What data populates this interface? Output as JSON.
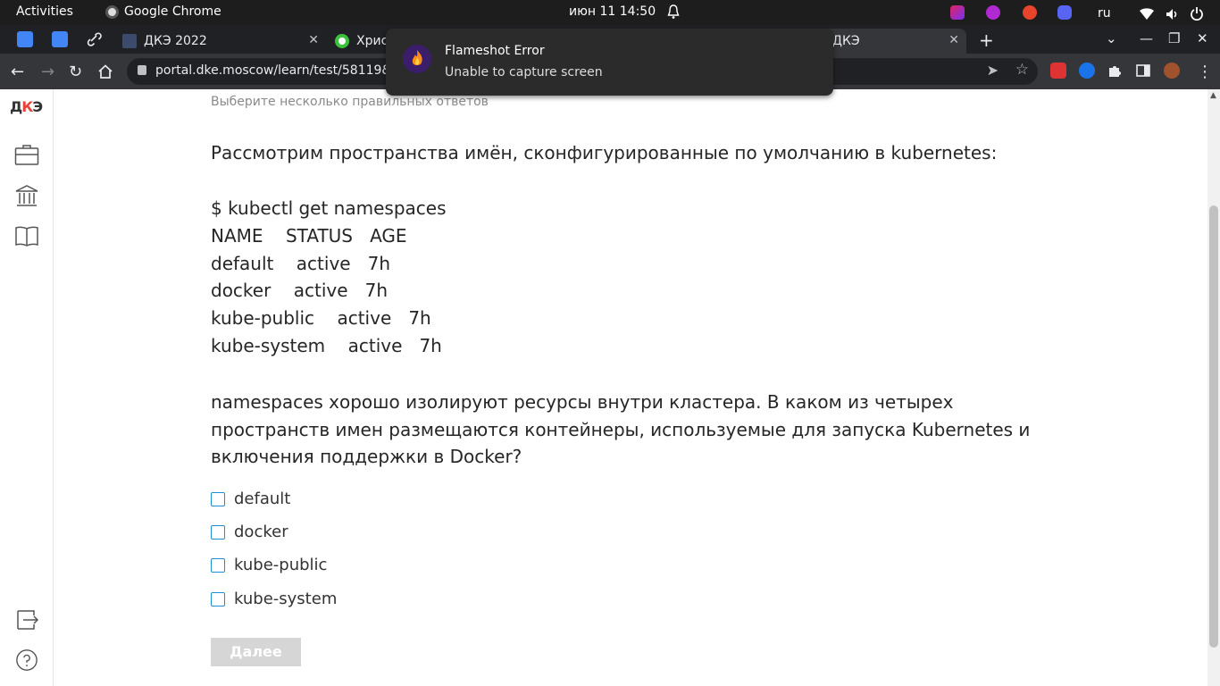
{
  "topbar": {
    "activities": "Activities",
    "app_name": "Google Chrome",
    "clock": "июн 11  14:50",
    "lang": "ru"
  },
  "tabs": {
    "tab1_title": "ДКЭ 2022",
    "tab2_title": "Хрис",
    "tab3_title": "ДКЭ"
  },
  "toolbar": {
    "url": "portal.dke.moscow/learn/test/58119&exe"
  },
  "notification": {
    "title": "Flameshot Error",
    "body": "Unable to capture screen"
  },
  "sidebar": {
    "logo_d": "Д",
    "logo_k": "К",
    "logo_e": "Э"
  },
  "question": {
    "hint": "Выберите несколько правильных ответов",
    "intro": "Рассмотрим пространства имён, сконфигурированные по умолчанию в kubernetes:",
    "cmd_lines": [
      "$ kubectl get namespaces",
      "NAME    STATUS   AGE",
      "default    active   7h",
      "docker    active   7h",
      "kube-public    active   7h",
      "kube-system    active   7h"
    ],
    "prompt": "namespaces хорошо изолируют ресурсы внутри кластера. В каком из четырех пространств имен размещаются контейнеры, используемые для запуска Kubernetes и включения поддержки в Docker?",
    "options": [
      "default",
      "docker",
      "kube-public",
      "kube-system"
    ],
    "next_label": "Далее"
  },
  "colors": {
    "accent": "#1e8fd0",
    "logo_red": "#e8423a",
    "button_disabled": "#d6d6d6"
  }
}
